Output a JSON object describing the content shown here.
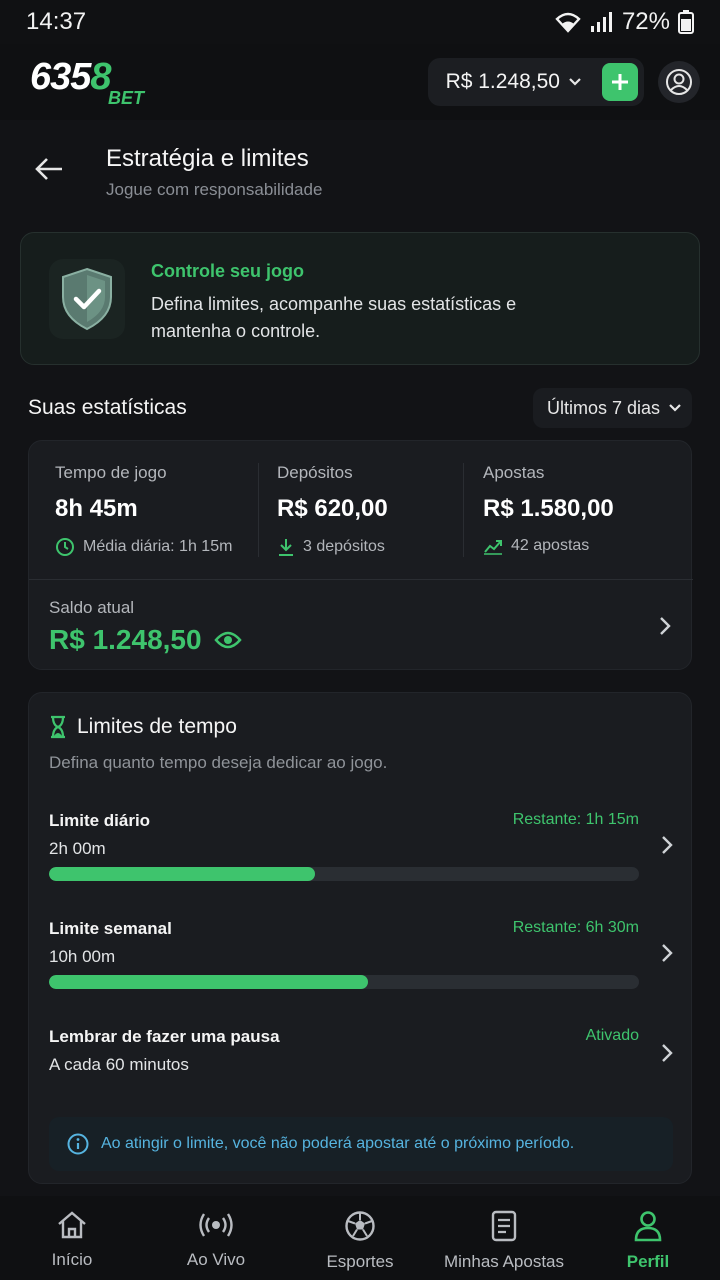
{
  "status": {
    "time": "14:37",
    "battery": "72%"
  },
  "topbar": {
    "logo_num_white": "635",
    "logo_num_green": "8",
    "logo_sub": "BET",
    "balance": "R$ 1.248,50"
  },
  "header": {
    "title": "Estratégia e limites",
    "subtitle": "Jogue com responsabilidade"
  },
  "hero": {
    "title": "Controle seu jogo",
    "text": "Defina limites, acompanhe suas estatísticas e mantenha o controle."
  },
  "stats": {
    "title": "Suas estatísticas",
    "period": "Últimos 7 dias",
    "columns": [
      {
        "label": "Tempo de jogo",
        "value": "8h 45m",
        "foot": "Média diária: 1h 15m",
        "icon": "clock-icon"
      },
      {
        "label": "Depósitos",
        "value": "R$ 620,00",
        "foot": "3 depósitos",
        "icon": "download-icon"
      },
      {
        "label": "Apostas",
        "value": "R$ 1.580,00",
        "foot": "42 apostas",
        "icon": "trend-icon"
      }
    ],
    "saldo_label": "Saldo atual",
    "saldo_value": "R$ 1.248,50"
  },
  "limits": {
    "title": "Limites de tempo",
    "subtitle": "Defina quanto tempo deseja dedicar ao jogo.",
    "rows": [
      {
        "name": "Limite diário",
        "value": "2h 00m",
        "remaining": "Restante: 1h 15m",
        "progress": 0.45
      },
      {
        "name": "Limite semanal",
        "value": "10h 00m",
        "remaining": "Restante: 6h 30m",
        "progress": 0.54
      },
      {
        "name": "Lembrar de fazer uma pausa",
        "value": "A cada 60 minutos",
        "remaining": "Ativado"
      }
    ],
    "info": "Ao atingir o limite, você não poderá apostar até o próximo período."
  },
  "nav": [
    {
      "label": "Início"
    },
    {
      "label": "Ao Vivo"
    },
    {
      "label": "Esportes"
    },
    {
      "label": "Minhas Apostas"
    },
    {
      "label": "Perfil"
    }
  ],
  "colors": {
    "accent": "#3ec46d",
    "background": "#121316",
    "card": "#1a1c20",
    "info": "#56b4e0"
  }
}
